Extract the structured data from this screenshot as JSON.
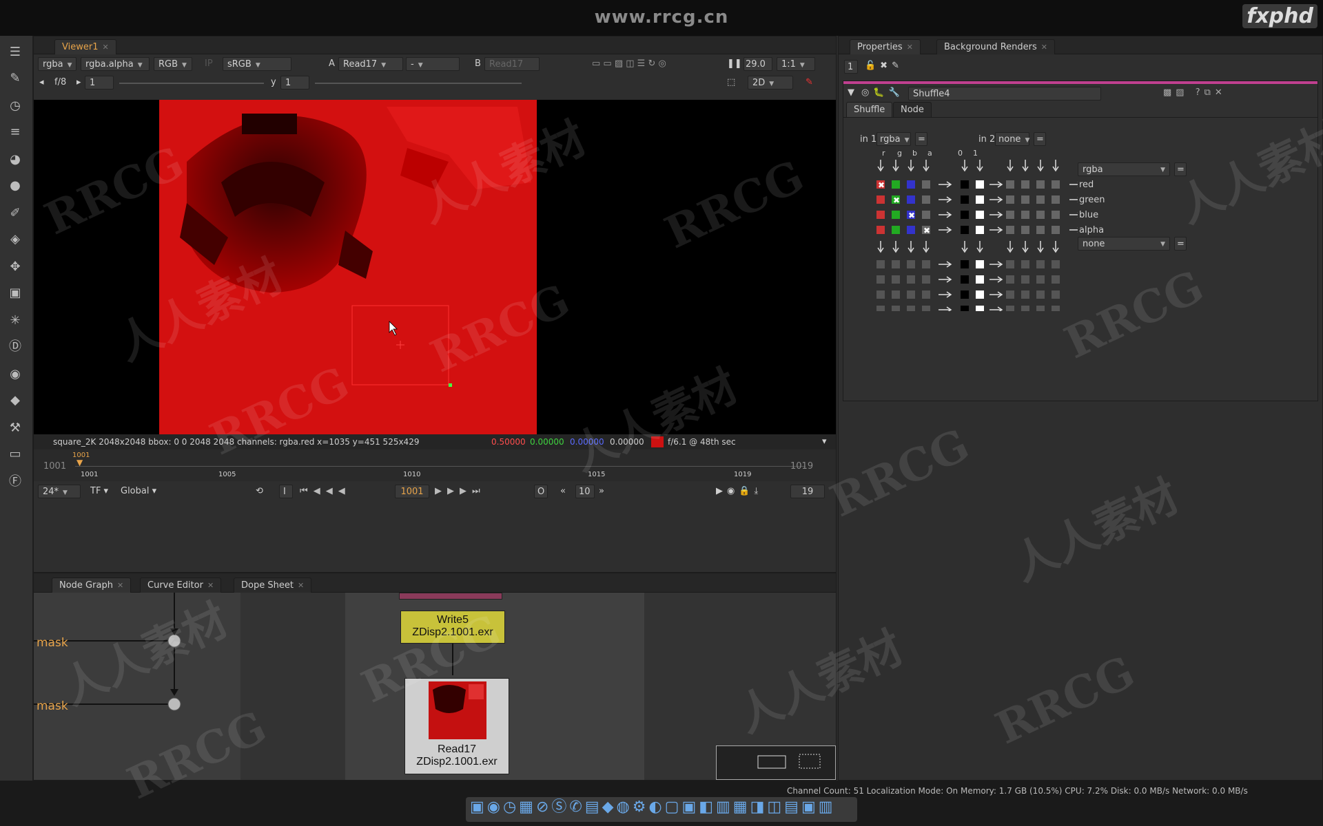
{
  "header": {
    "site": "www.rrcg.cn",
    "brand": "fxphd"
  },
  "viewer": {
    "tab": "Viewer1",
    "channels": "rgba",
    "channel_alpha": "rgba.alpha",
    "colorspace_rgb": "RGB",
    "ip": "IP",
    "lut": "sRGB",
    "input_a_letter": "A",
    "input_a": "Read17",
    "input_dash": "-",
    "input_b_letter": "B",
    "input_b": "Read17",
    "fps_display": "29.0",
    "zoom": "1:1",
    "fstop": "f/8",
    "gain_value": "1",
    "gamma_label": "y",
    "gamma_value": "1",
    "view_mode": "2D",
    "info_format": "square_2K 2048x2048  bbox: 0 0 2048 2048 channels: rgba.red  x=1035 y=451 525x429",
    "info_r": "0.50000",
    "info_g": "0.00000",
    "info_b": "0.00000",
    "info_a": "0.00000",
    "info_time": "f/6.1 @ 48th sec",
    "swatch_color": "#cc1111"
  },
  "timeline": {
    "start": "1001",
    "end": "1019",
    "current_marker": "1001",
    "ticks": [
      "1001",
      "1005",
      "1010",
      "1015",
      "1019"
    ],
    "fps": "24*",
    "tf": "TF",
    "scope": "Global",
    "in_label": "I",
    "out_label": "O",
    "current_frame": "1001",
    "step": "10",
    "end_frame": "19"
  },
  "properties": {
    "tab_properties": "Properties",
    "tab_renders": "Background Renders",
    "count": "1",
    "node_name": "Shuffle4",
    "subtab_shuffle": "Shuffle",
    "subtab_node": "Node",
    "in1_label": "in 1",
    "in1_value": "rgba",
    "in2_label": "in 2",
    "in2_value": "none",
    "col_headers": [
      "r",
      "g",
      "b",
      "a",
      "0",
      "1"
    ],
    "out1_value": "rgba",
    "out2_value": "none",
    "out_channels": [
      "red",
      "green",
      "blue",
      "alpha"
    ]
  },
  "bottom_tabs": [
    "Node Graph",
    "Curve Editor",
    "Dope Sheet"
  ],
  "nodegraph": {
    "mask1": "mask",
    "mask2": "mask",
    "write_name": "Write5",
    "write_file": "ZDisp2.1001.exr",
    "read_name": "Read17",
    "read_file": "ZDisp2.1001.exr"
  },
  "status": "Channel Count: 51  Localization Mode: On  Memory: 1.7 GB (10.5%)  CPU: 7.2%  Disk: 0.0 MB/s  Network: 0.0 MB/s",
  "watermarks": [
    "RRCG",
    "人人素材"
  ]
}
